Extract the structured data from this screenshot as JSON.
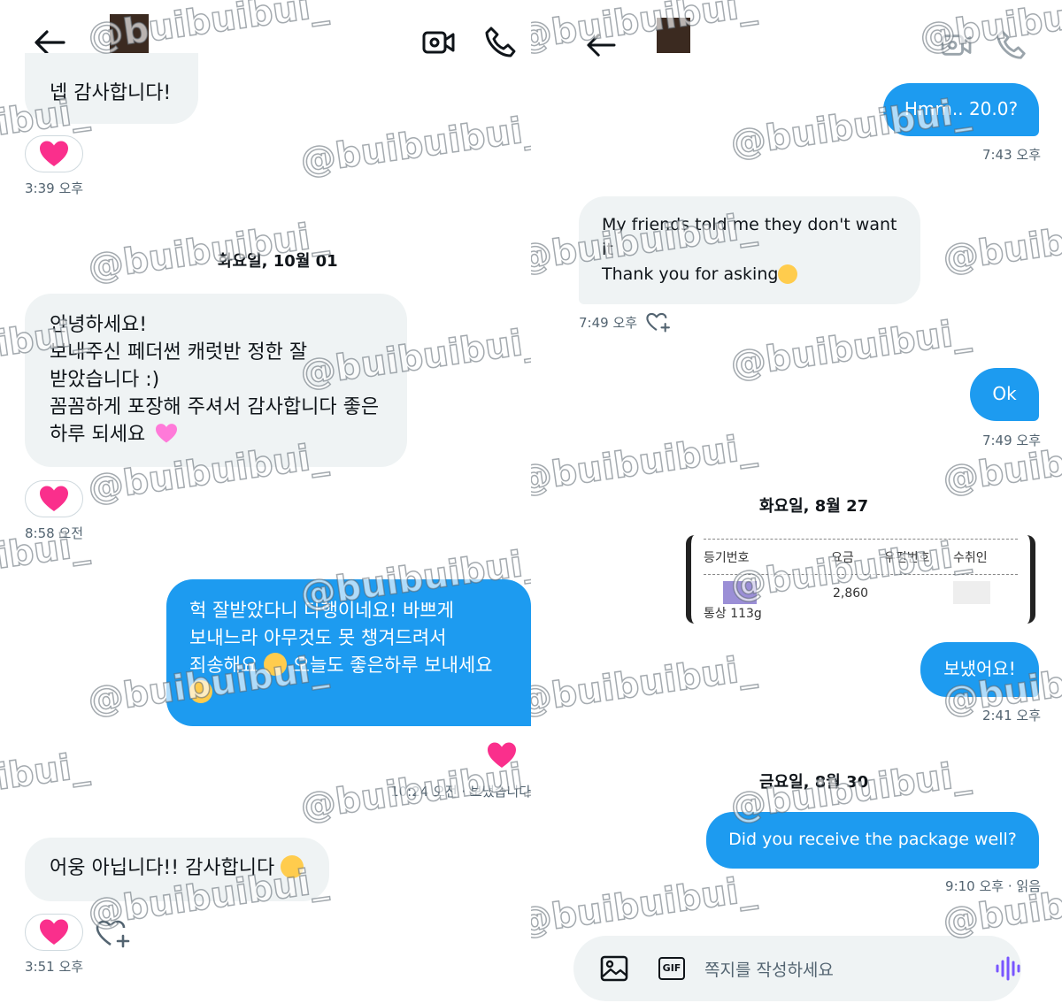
{
  "watermark": "@buibuibui_",
  "colors": {
    "accent": "#1d9bf0",
    "incoming": "#eff3f4",
    "heart": "#f91880",
    "voice": "#7856ff"
  },
  "left": {
    "header": {
      "back_icon": "arrow-left-icon",
      "video_icon": "video-call-icon",
      "phone_icon": "phone-call-icon"
    },
    "msg1": {
      "text": "넵 감사합니다!",
      "time": "3:39 오후"
    },
    "date1": "화요일, 10월 01",
    "msg2": {
      "lines": [
        "안녕하세요!",
        "보내주신 페더썬 캐럿반 정한 잘",
        "받았습니다 :)",
        "꼼꼼하게 포장해 주셔서 감사합니다 좋은",
        "하루 되세요"
      ],
      "time": "8:58 오전"
    },
    "msg3": {
      "lines": [
        "헉 잘받았다니 다행이네요! 바쁘게",
        "보내느라 아무것도 못 챙겨드려서",
        "죄송해요",
        "오늘도 좋은하루 보내세요"
      ],
      "time": "10:24 오전 · 보냈습니다"
    },
    "msg4": {
      "text": "어웅 아닙니다!! 감사합니다",
      "time": "3:51 오후"
    }
  },
  "right": {
    "header": {
      "back_icon": "arrow-left-icon",
      "video_icon": "video-call-icon",
      "phone_icon": "phone-call-icon"
    },
    "m1": {
      "text": "Hmm.. 20.0?",
      "time": "7:43 오후"
    },
    "m2": {
      "line1": "My friends told me they don't want",
      "line2": "it",
      "line3": "Thank you for asking",
      "time": "7:49 오후"
    },
    "m3": {
      "text": "Ok",
      "time": "7:49 오후"
    },
    "date1": "화요일, 8월 27",
    "receipt": {
      "col1": "등기번호",
      "col2": "요금",
      "col3": "우편번호",
      "col4": "수취인",
      "fee": "2,860",
      "type": "통상 113g"
    },
    "m4": {
      "text": "보냈어요!",
      "time": "2:41 오후"
    },
    "date2": "금요일, 8월 30",
    "m5": {
      "text": "Did you receive the package well?",
      "time": "9:10 오후 · 읽음"
    },
    "composer": {
      "placeholder": "쪽지를 작성하세요",
      "gif": "GIF"
    }
  }
}
